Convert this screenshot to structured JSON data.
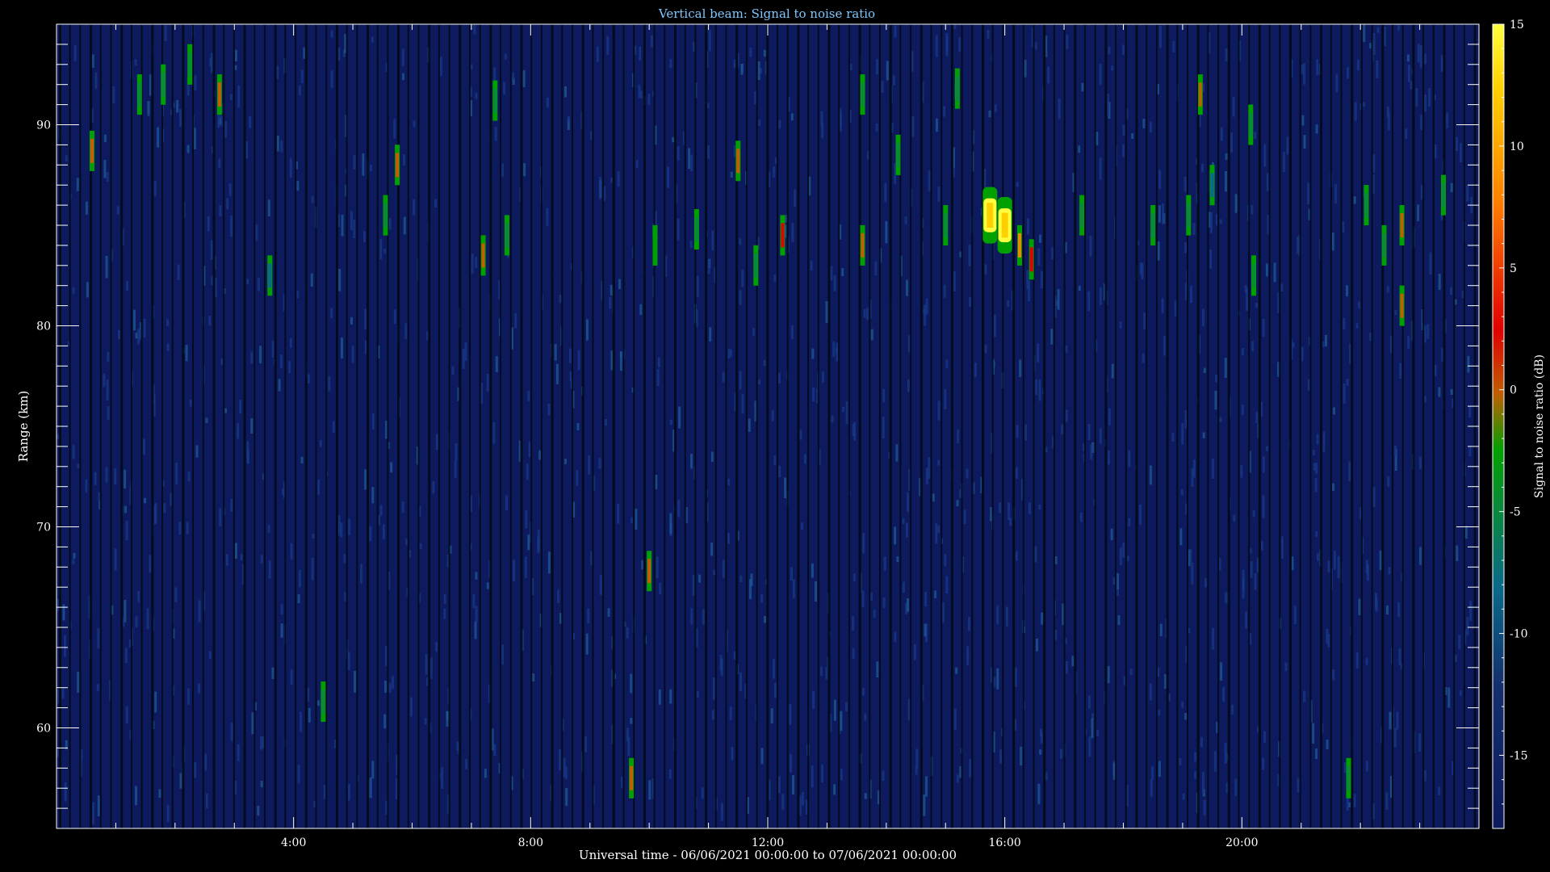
{
  "colors": {
    "background": "#000000",
    "title": "#7ec8ff",
    "axis": "#ffffff",
    "colormap": [
      "#0e1a5e",
      "#14306e",
      "#0a6a8a",
      "#0a8a3a",
      "#00a000",
      "#c06000",
      "#e00000",
      "#ff8000",
      "#ffd000",
      "#ffff40"
    ]
  },
  "chart_data": {
    "type": "heatmap",
    "title": "Vertical beam: Signal to noise ratio",
    "xlabel": "Universal time - 06/06/2021 00:00:00 to 07/06/2021 00:00:00",
    "ylabel": "Range (km)",
    "colorbar_label": "Signal to noise ratio (dB)",
    "x_range_hours": [
      0,
      24
    ],
    "x_ticks": [
      {
        "value": 4,
        "label": "4:00"
      },
      {
        "value": 8,
        "label": "8:00"
      },
      {
        "value": 12,
        "label": "12:00"
      },
      {
        "value": 16,
        "label": "16:00"
      },
      {
        "value": 20,
        "label": "20:00"
      }
    ],
    "y_range_km": [
      55,
      95
    ],
    "y_ticks": [
      {
        "value": 60,
        "label": "60"
      },
      {
        "value": 70,
        "label": "70"
      },
      {
        "value": 80,
        "label": "80"
      },
      {
        "value": 90,
        "label": "90"
      }
    ],
    "color_range_db": [
      -18,
      15
    ],
    "colorbar_ticks": [
      {
        "value": 15,
        "label": "15"
      },
      {
        "value": 10,
        "label": "10"
      },
      {
        "value": 5,
        "label": "5"
      },
      {
        "value": 0,
        "label": "0"
      },
      {
        "value": -5,
        "label": "-5"
      },
      {
        "value": -10,
        "label": "-10"
      },
      {
        "value": -15,
        "label": "-15"
      }
    ],
    "background_db": -15,
    "echoes": [
      {
        "t": 0.6,
        "r": 88.7,
        "db": 2
      },
      {
        "t": 1.4,
        "r": 91.5,
        "db": -6
      },
      {
        "t": 1.8,
        "r": 92.0,
        "db": -6
      },
      {
        "t": 2.25,
        "r": 93.0,
        "db": -6
      },
      {
        "t": 2.75,
        "r": 91.5,
        "db": 1
      },
      {
        "t": 3.6,
        "r": 82.5,
        "db": -9
      },
      {
        "t": 4.5,
        "r": 61.3,
        "db": -8
      },
      {
        "t": 5.55,
        "r": 85.5,
        "db": -6
      },
      {
        "t": 5.75,
        "r": 88.0,
        "db": 0
      },
      {
        "t": 7.2,
        "r": 83.5,
        "db": 0
      },
      {
        "t": 7.4,
        "r": 91.2,
        "db": -6
      },
      {
        "t": 7.6,
        "r": 84.5,
        "db": -6
      },
      {
        "t": 9.7,
        "r": 57.5,
        "db": 1
      },
      {
        "t": 10.0,
        "r": 67.8,
        "db": 2
      },
      {
        "t": 10.1,
        "r": 84.0,
        "db": -5
      },
      {
        "t": 10.8,
        "r": 84.8,
        "db": -6
      },
      {
        "t": 11.5,
        "r": 88.2,
        "db": 2
      },
      {
        "t": 11.8,
        "r": 83.0,
        "db": -6
      },
      {
        "t": 12.25,
        "r": 84.5,
        "db": 3
      },
      {
        "t": 13.6,
        "r": 91.5,
        "db": -6
      },
      {
        "t": 13.6,
        "r": 84.0,
        "db": 2
      },
      {
        "t": 14.2,
        "r": 88.5,
        "db": -8
      },
      {
        "t": 15.0,
        "r": 85.0,
        "db": -6
      },
      {
        "t": 15.2,
        "r": 91.8,
        "db": -6
      },
      {
        "t": 15.75,
        "r": 85.5,
        "db": 14
      },
      {
        "t": 16.0,
        "r": 85.0,
        "db": 14
      },
      {
        "t": 16.25,
        "r": 84.0,
        "db": 6
      },
      {
        "t": 16.45,
        "r": 83.3,
        "db": 3
      },
      {
        "t": 17.3,
        "r": 85.5,
        "db": -8
      },
      {
        "t": 18.5,
        "r": 85.0,
        "db": -8
      },
      {
        "t": 19.1,
        "r": 85.5,
        "db": -8
      },
      {
        "t": 19.3,
        "r": 91.5,
        "db": 2
      },
      {
        "t": 19.5,
        "r": 87.0,
        "db": -10
      },
      {
        "t": 20.15,
        "r": 90.0,
        "db": -6
      },
      {
        "t": 20.2,
        "r": 82.5,
        "db": -6
      },
      {
        "t": 21.8,
        "r": 57.5,
        "db": -8
      },
      {
        "t": 22.1,
        "r": 86.0,
        "db": -6
      },
      {
        "t": 22.4,
        "r": 84.0,
        "db": -6
      },
      {
        "t": 22.7,
        "r": 85.0,
        "db": 0
      },
      {
        "t": 22.7,
        "r": 81.0,
        "db": 2
      },
      {
        "t": 23.4,
        "r": 86.5,
        "db": -6
      }
    ]
  }
}
